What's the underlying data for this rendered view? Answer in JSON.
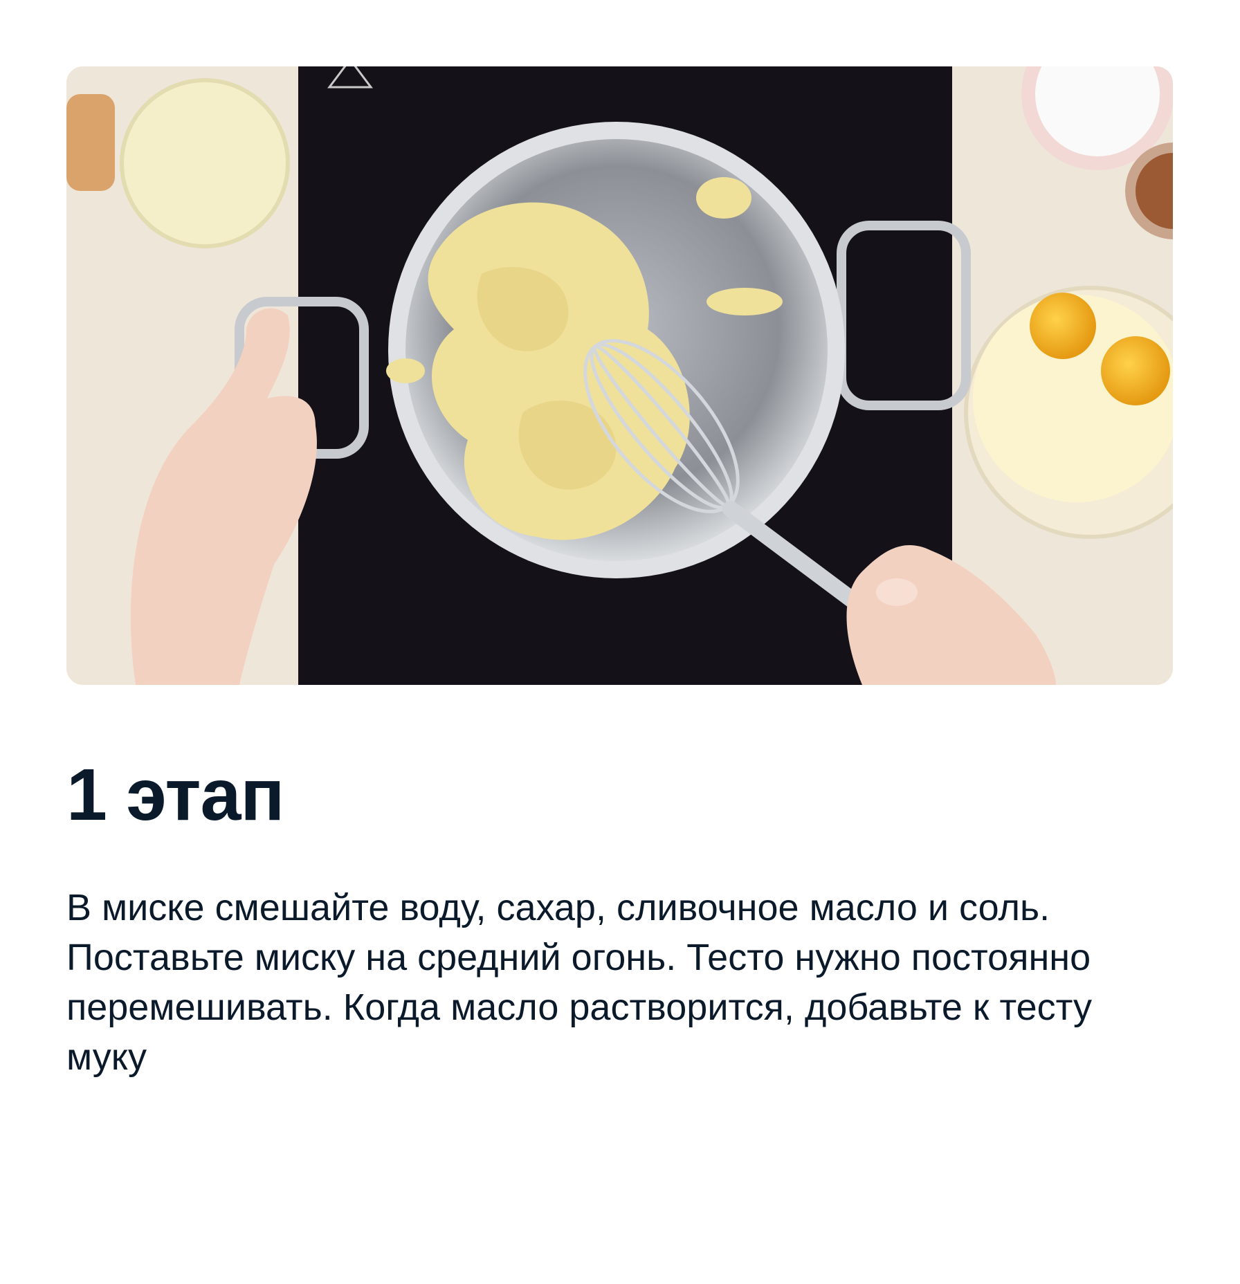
{
  "step": {
    "title": "1 этап",
    "description": "В миске смешайте воду, сахар, сливочное масло и соль. Поставьте миску на средний огонь. Тесто нужно постоянно перемешивать. Когда масло растворится, добавьте к тесту муку"
  },
  "photo": {
    "icon": "cooking-photo-icon"
  },
  "colors": {
    "text": "#0b1a2b",
    "background": "#ffffff",
    "countertop": "#efe6da",
    "stove": "#141218"
  }
}
